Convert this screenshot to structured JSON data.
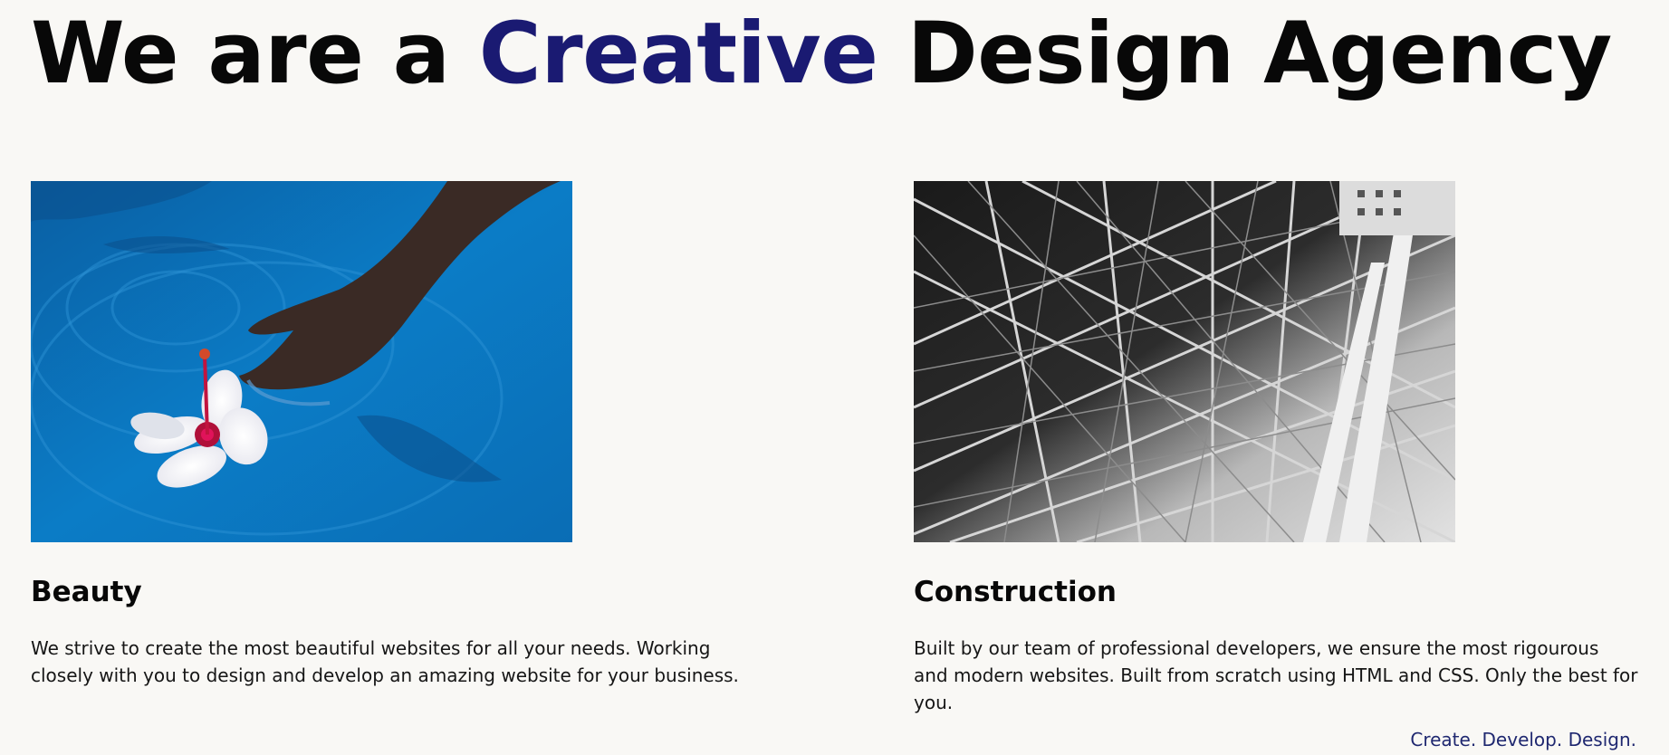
{
  "hero": {
    "prefix": "We are a ",
    "accent": "Creative",
    "suffix": " Design Agency"
  },
  "colors": {
    "background": "#f9f8f5",
    "accent": "#1a1a72",
    "tagline": "#1f2870"
  },
  "cards": [
    {
      "image_subject": "hand-touching-water-with-hibiscus-flower",
      "title": "Beauty",
      "text": "We strive to create the most beautiful websites for all your needs. Working closely with you to design and develop an amazing website for your business."
    },
    {
      "image_subject": "steel-lattice-structure-black-and-white",
      "title": "Construction",
      "text": "Built by our team of professional developers, we ensure the most rigourous and modern websites. Built from scratch using HTML and CSS. Only the best for you."
    }
  ],
  "tagline": "Create. Develop. Design."
}
